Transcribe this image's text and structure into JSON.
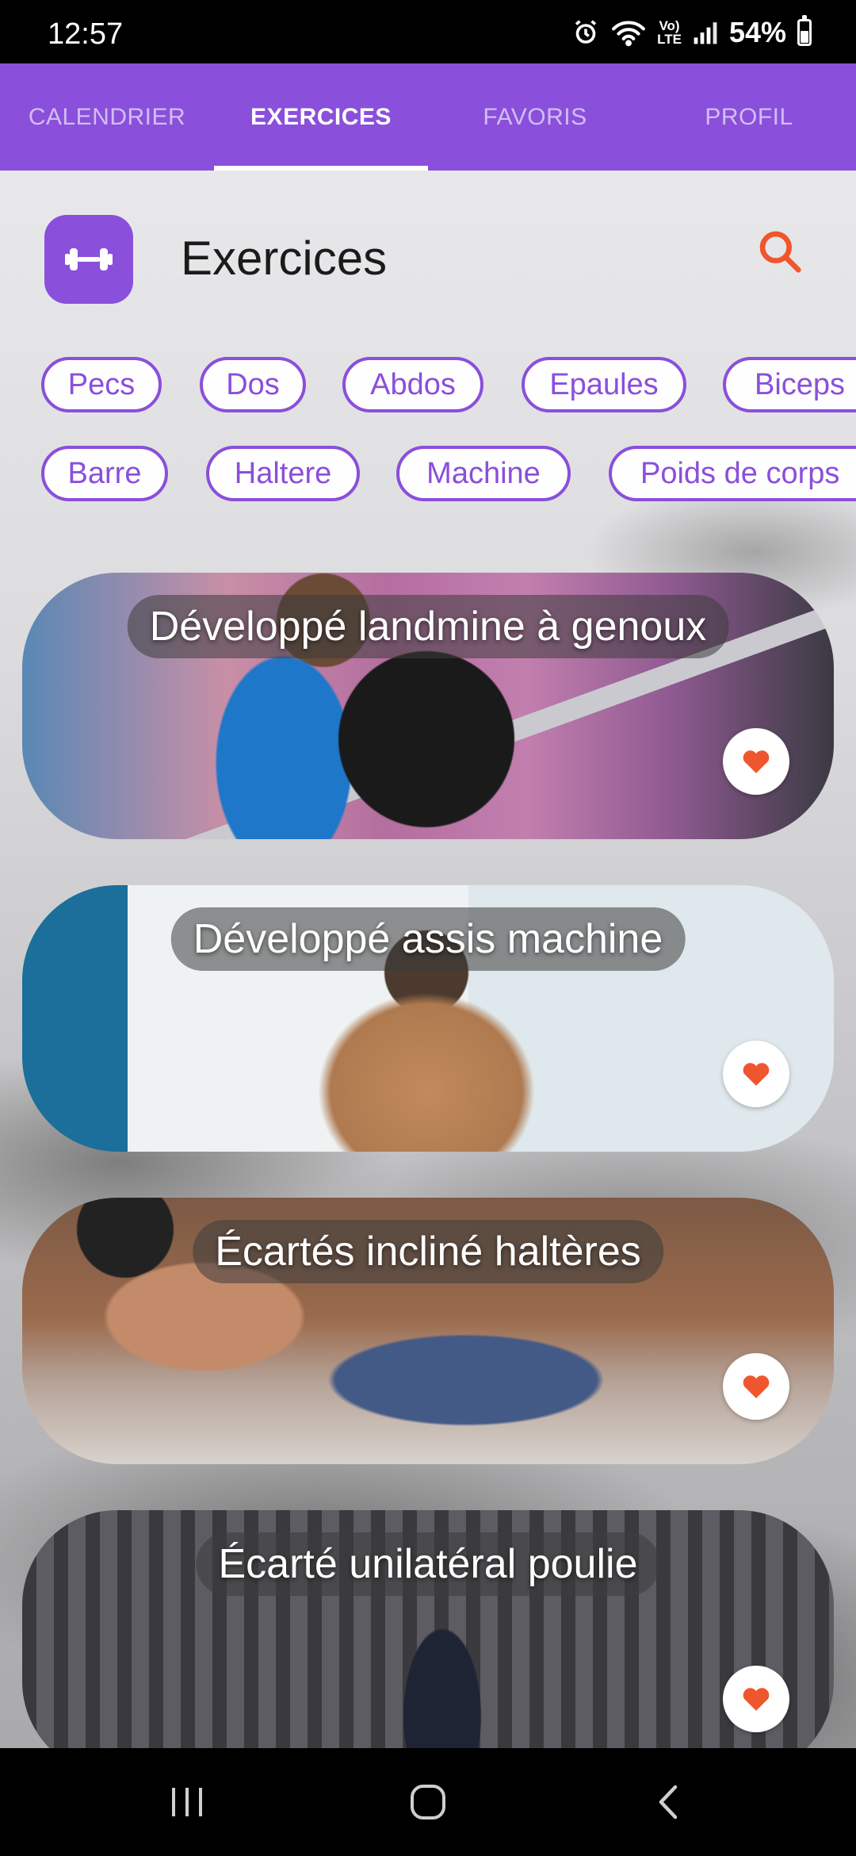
{
  "status_bar": {
    "time": "12:57",
    "volte_line1": "Vo)",
    "volte_line2": "LTE",
    "battery": "54%",
    "battery_level": 0.54
  },
  "tabs": [
    {
      "label": "CALENDRIER",
      "active": false
    },
    {
      "label": "EXERCICES",
      "active": true
    },
    {
      "label": "FAVORIS",
      "active": false
    },
    {
      "label": "PROFIL",
      "active": false
    }
  ],
  "header": {
    "title": "Exercices"
  },
  "filters": {
    "muscles": [
      "Pecs",
      "Dos",
      "Abdos",
      "Epaules",
      "Biceps"
    ],
    "equipment": [
      "Barre",
      "Haltere",
      "Machine",
      "Poids de corps"
    ]
  },
  "exercises": [
    {
      "title": "Développé landmine à genoux"
    },
    {
      "title": "Développé assis machine"
    },
    {
      "title": "Écartés incliné haltères"
    },
    {
      "title": "Écarté unilatéral poulie"
    }
  ],
  "colors": {
    "accent": "#8a4fdb",
    "search_icon": "#f0562d",
    "favorite_heart": "#f0562d"
  },
  "icons": {
    "logo": "dumbbell-icon",
    "search": "search-icon",
    "favorite": "heart-icon"
  }
}
